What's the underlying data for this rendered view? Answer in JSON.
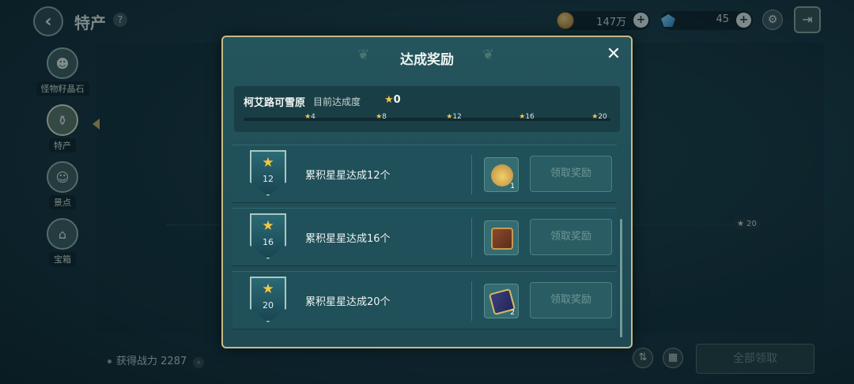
{
  "topbar": {
    "back_icon": "back-arrow-icon",
    "title": "特产",
    "help_label": "?",
    "gold_value": "147万",
    "gem_value": "45",
    "plus_label": "+",
    "colors": {
      "accent_gold": "#c7ba84",
      "star": "#f2c744"
    }
  },
  "sidenav": {
    "items": [
      {
        "label": "怪物籽晶石",
        "icon": "monster-crystal-icon"
      },
      {
        "label": "特产",
        "icon": "specialty-bag-icon",
        "active": true
      },
      {
        "label": "景点",
        "icon": "scenery-icon"
      },
      {
        "label": "宝箱",
        "icon": "treasure-chest-icon"
      }
    ]
  },
  "background": {
    "star_tick": "20"
  },
  "bottom": {
    "power_label": "获得战力",
    "power_value": "2287",
    "claim_all_label": "全部领取"
  },
  "modal": {
    "title": "达成奖励",
    "close_label": "✕",
    "region": {
      "name": "柯艾路可雪原",
      "progress_label": "目前达成度",
      "progress_value": "0",
      "ticks": [
        "4",
        "8",
        "12",
        "16",
        "20"
      ]
    },
    "rewards": [
      {
        "threshold": "12",
        "text": "累积星星达成12个",
        "item_icon": "gold-bag-icon",
        "item_count": "1",
        "claim_label": "领取奖励"
      },
      {
        "threshold": "16",
        "text": "累积星星达成16个",
        "item_icon": "book-icon",
        "item_count": "",
        "claim_label": "领取奖励"
      },
      {
        "threshold": "20",
        "text": "累积星星达成20个",
        "item_icon": "card-icon",
        "item_count": "2",
        "claim_label": "领取奖励"
      }
    ]
  }
}
